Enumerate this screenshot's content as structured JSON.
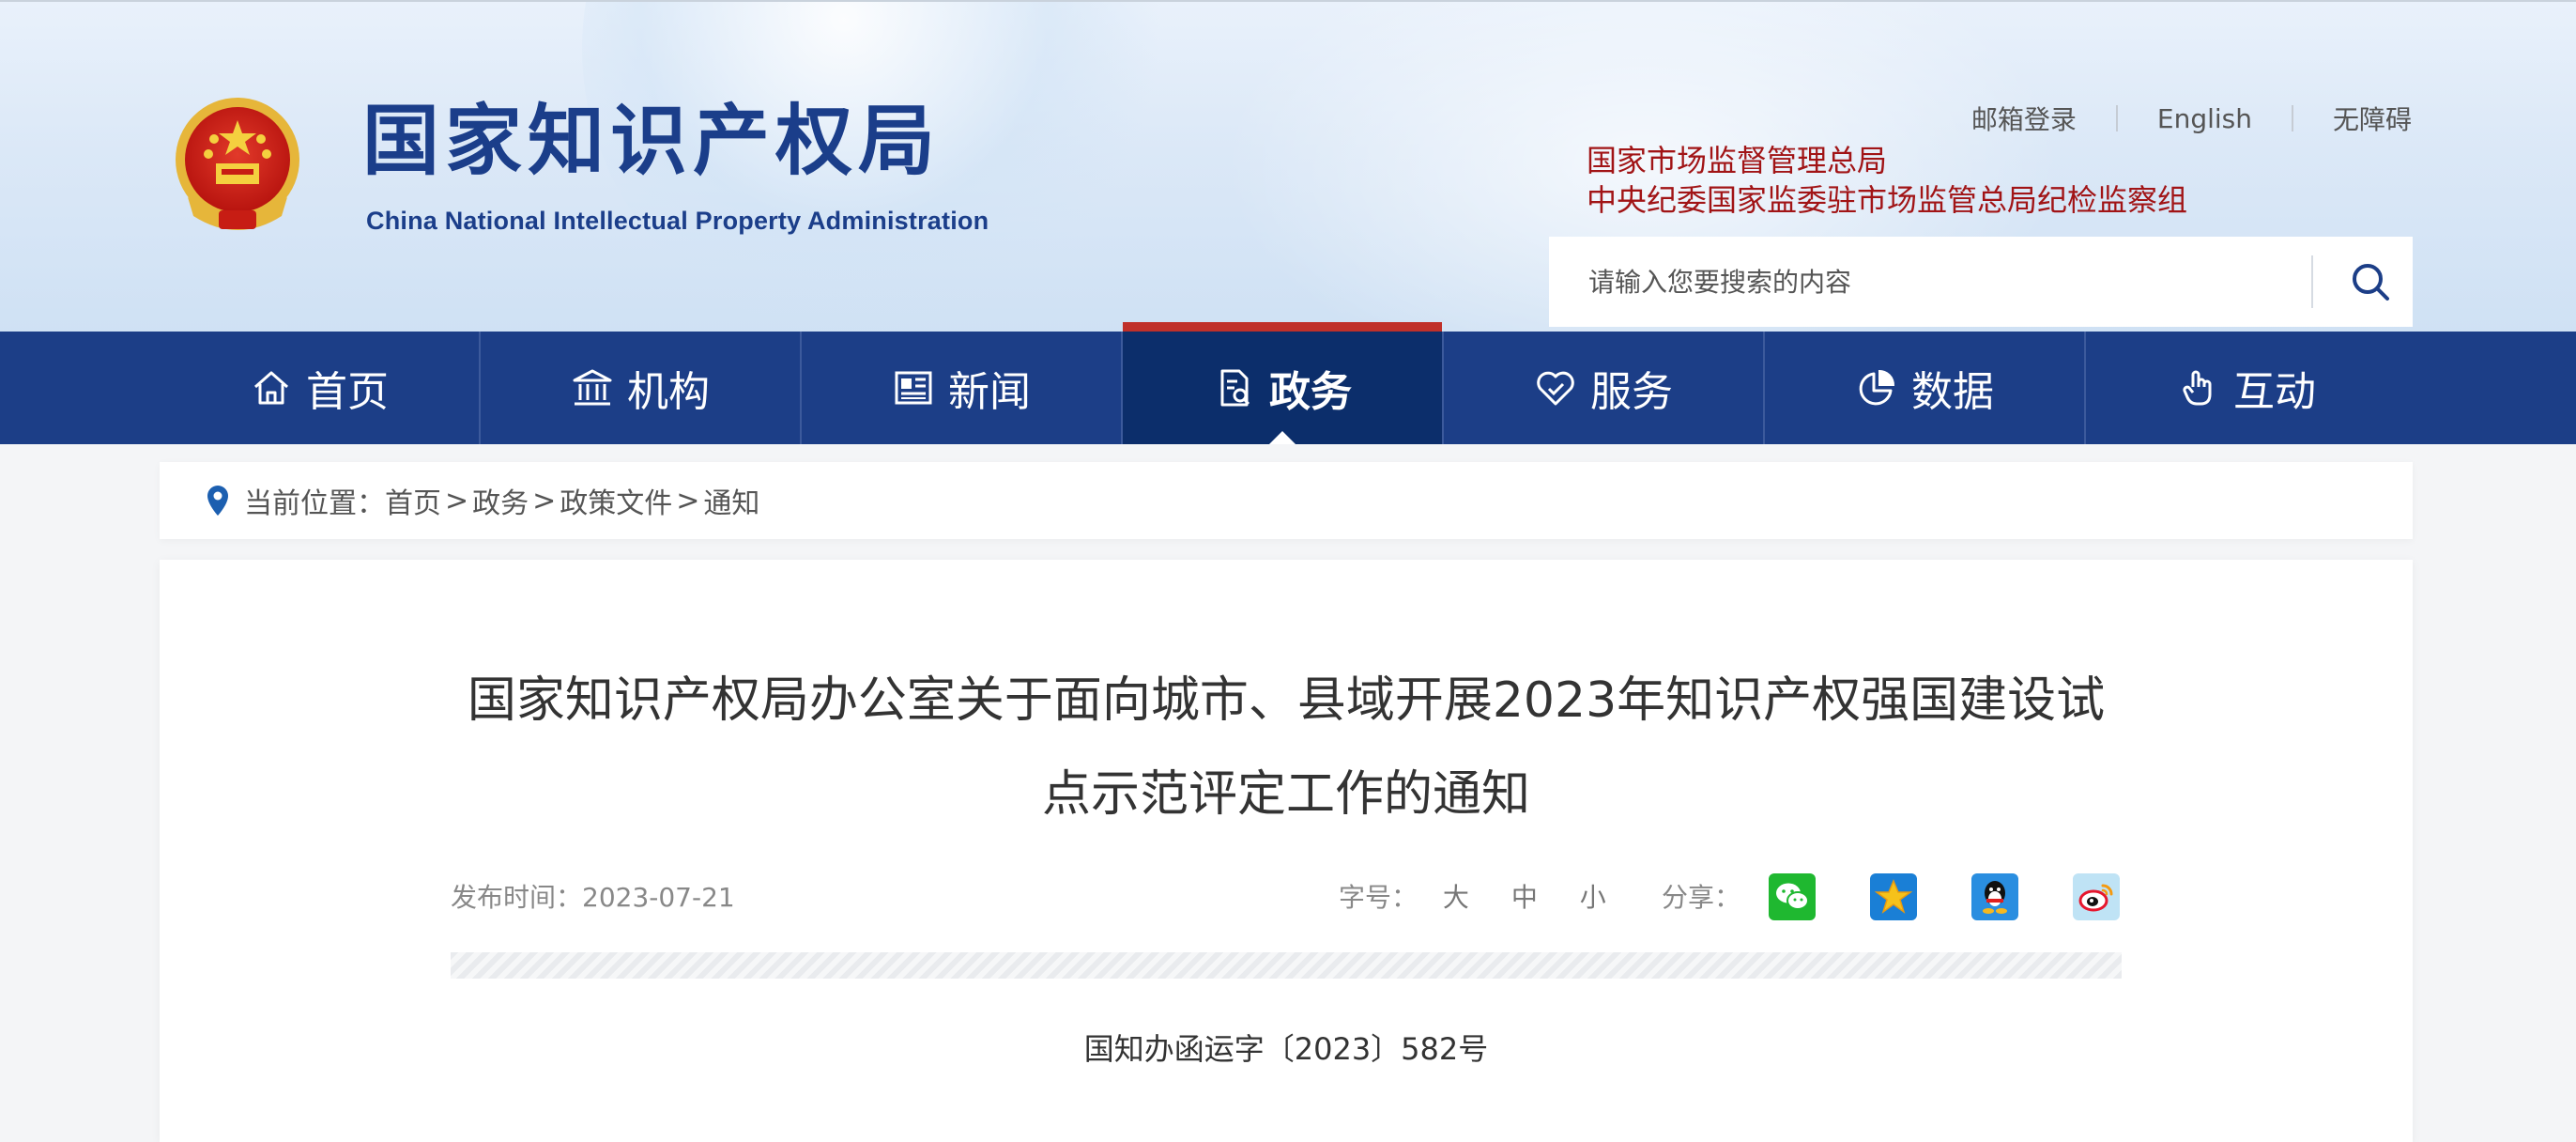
{
  "header": {
    "logo_cn": "国家知识产权局",
    "logo_en": "China National Intellectual Property Administration",
    "top_links": [
      "邮箱登录",
      "English",
      "无障碍"
    ],
    "affiliations": [
      "国家市场监督管理总局",
      "中央纪委国家监委驻市场监管总局纪检监察组"
    ],
    "search": {
      "placeholder": "请输入您要搜索的内容"
    }
  },
  "nav": {
    "items": [
      {
        "label": "首页",
        "icon": "home-icon"
      },
      {
        "label": "机构",
        "icon": "institution-icon"
      },
      {
        "label": "新闻",
        "icon": "news-icon"
      },
      {
        "label": "政务",
        "icon": "affairs-icon",
        "active": true
      },
      {
        "label": "服务",
        "icon": "service-icon"
      },
      {
        "label": "数据",
        "icon": "data-pie-icon"
      },
      {
        "label": "互动",
        "icon": "interaction-icon"
      }
    ]
  },
  "breadcrumb": {
    "prefix": "当前位置：",
    "items": [
      "首页",
      "政务",
      "政策文件",
      "通知"
    ],
    "separator": ">"
  },
  "article": {
    "title_line1": "国家知识产权局办公室关于面向城市、县域开展2023年知识产权强国建设试",
    "title_line2": "点示范评定工作的通知",
    "date_label": "发布时间：2023-07-21",
    "font_size_label": "字号：",
    "font_sizes": [
      "大",
      "中",
      "小"
    ],
    "share_label": "分享：",
    "share_targets": [
      "wechat-icon",
      "qzone-icon",
      "qq-icon",
      "weibo-icon"
    ],
    "doc_number": "国知办函运字〔2023〕582号"
  },
  "colors": {
    "nav_bg": "#1c3e87",
    "nav_active_bg": "#0c2e6b",
    "nav_active_top": "#c0302a",
    "logo_blue": "#1b3e8a",
    "affiliation_red": "#a11416"
  }
}
